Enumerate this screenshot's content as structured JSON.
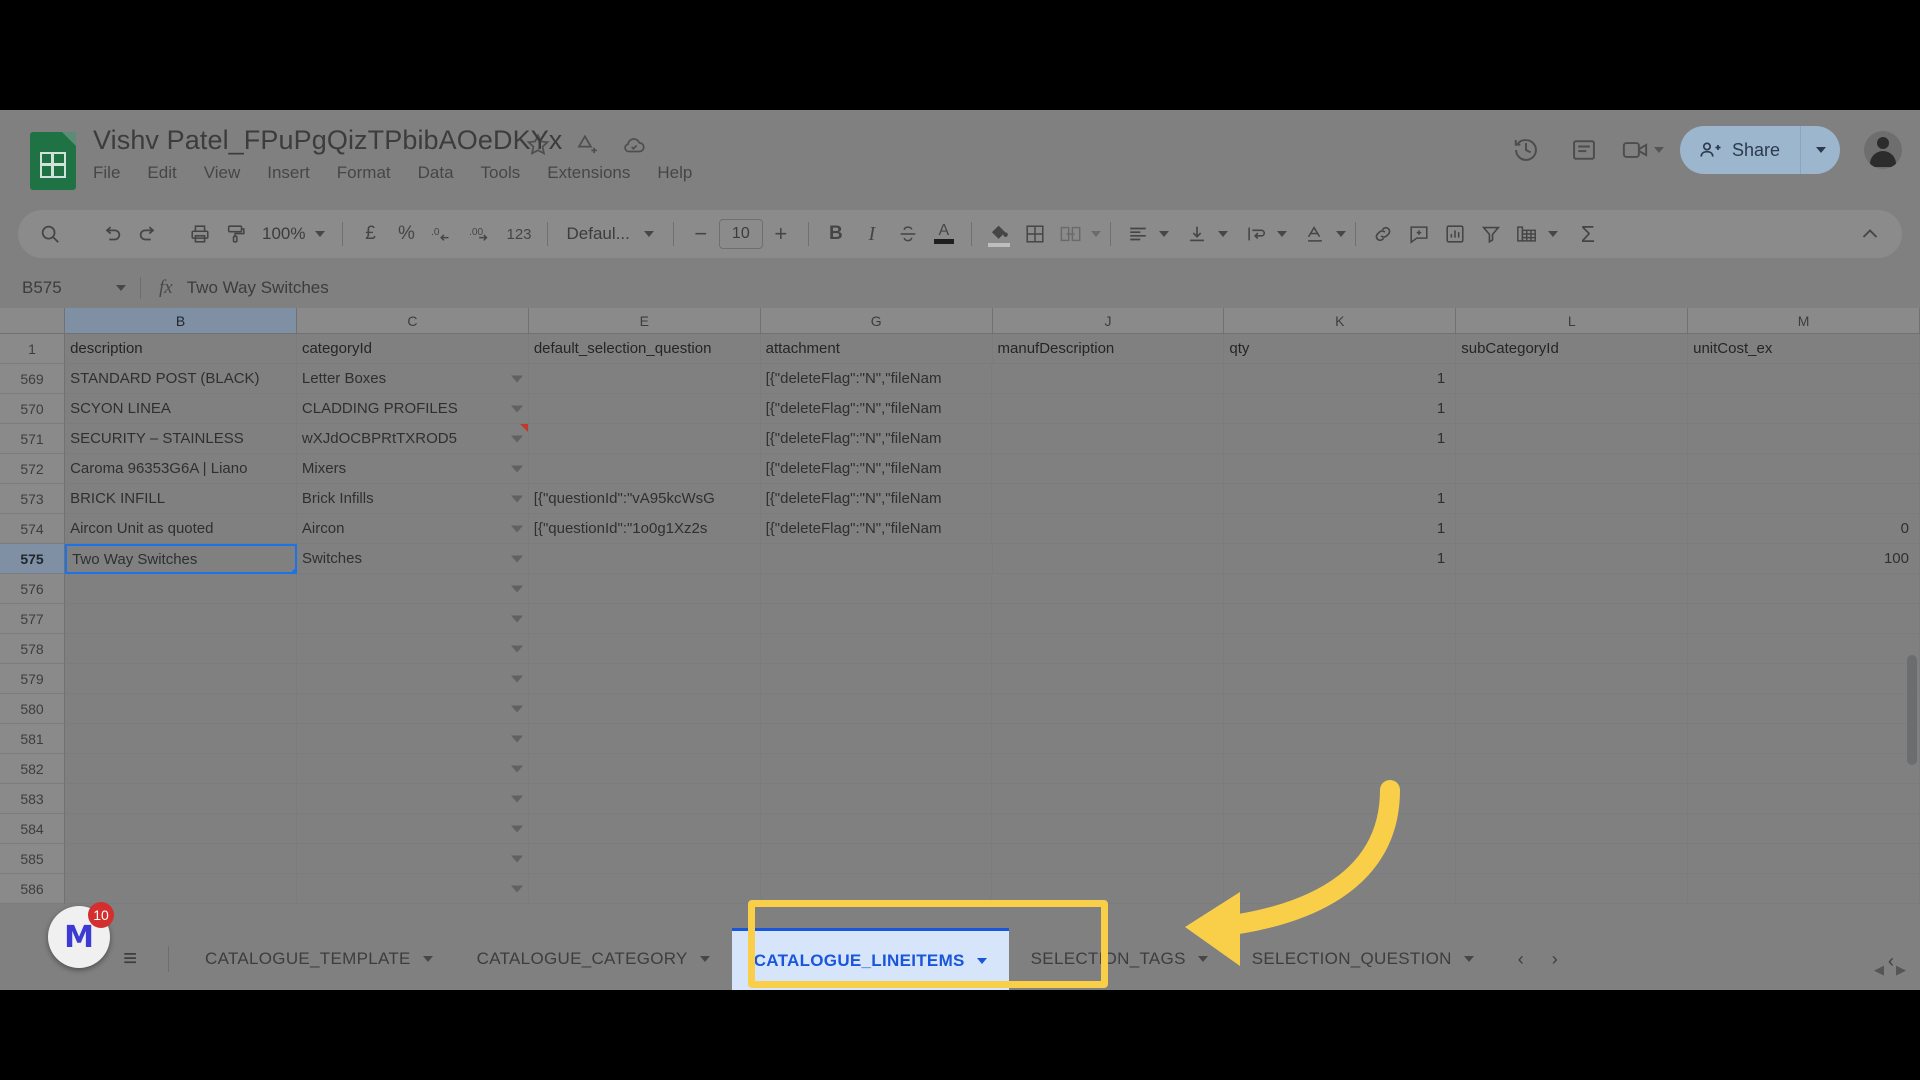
{
  "app": {
    "title": "Vishv Patel_FPuPgQizTPbibAOeDKYx",
    "menus": [
      "File",
      "Edit",
      "View",
      "Insert",
      "Format",
      "Data",
      "Tools",
      "Extensions",
      "Help"
    ],
    "share_label": "Share",
    "icons": {
      "star": "star-icon",
      "move": "move-to-drive-icon",
      "cloud": "saved-to-cloud-icon",
      "history": "version-history-icon",
      "comment": "open-comment-history-icon",
      "meet": "google-meet-icon",
      "avatar": "user-avatar"
    }
  },
  "toolbar": {
    "zoom": "100%",
    "font": "Defaul...",
    "font_size": "10",
    "currency": "£",
    "percent": "%",
    "dec_decrease": ".0",
    "dec_increase": ".00",
    "number_format": "123",
    "bold": "B",
    "italic": "I",
    "minus": "−",
    "plus": "+",
    "sigma": "Σ"
  },
  "formula_bar": {
    "cell_ref": "B575",
    "fx": "fx",
    "value": "Two Way Switches"
  },
  "grid": {
    "columns": [
      "B",
      "C",
      "E",
      "G",
      "J",
      "K",
      "L",
      "M"
    ],
    "selected_column": "B",
    "selected_row": "575",
    "header_row_number": "1",
    "headers": [
      "description",
      "categoryId",
      "default_selection_question",
      "attachment",
      "manufDescription",
      "qty",
      "subCategoryId",
      "unitCost_ex"
    ],
    "rows": [
      {
        "n": "569",
        "description": "STANDARD POST (BLACK)",
        "categoryId": "Letter Boxes",
        "default_selection_question": "",
        "attachment": "[{\"deleteFlag\":\"N\",\"fileNam",
        "manufDescription": "",
        "qty": "1",
        "subCategoryId": "",
        "unitCost_ex": "",
        "flag": false
      },
      {
        "n": "570",
        "description": "SCYON LINEA",
        "categoryId": "CLADDING PROFILES",
        "default_selection_question": "",
        "attachment": "[{\"deleteFlag\":\"N\",\"fileNam",
        "manufDescription": "",
        "qty": "1",
        "subCategoryId": "",
        "unitCost_ex": "",
        "flag": false
      },
      {
        "n": "571",
        "description": "SECURITY – STAINLESS",
        "categoryId": "wXJdOCBPRtTXROD5",
        "default_selection_question": "",
        "attachment": "[{\"deleteFlag\":\"N\",\"fileNam",
        "manufDescription": "",
        "qty": "1",
        "subCategoryId": "",
        "unitCost_ex": "",
        "flag": true
      },
      {
        "n": "572",
        "description": " Caroma 96353G6A | Liano",
        "categoryId": "Mixers",
        "default_selection_question": "",
        "attachment": "[{\"deleteFlag\":\"N\",\"fileNam",
        "manufDescription": "",
        "qty": "",
        "subCategoryId": "",
        "unitCost_ex": "",
        "flag": false
      },
      {
        "n": "573",
        "description": "BRICK INFILL",
        "categoryId": "Brick Infills",
        "default_selection_question": "[{\"questionId\":\"vA95kcWsG",
        "attachment": "[{\"deleteFlag\":\"N\",\"fileNam",
        "manufDescription": "",
        "qty": "1",
        "subCategoryId": "",
        "unitCost_ex": "",
        "flag": false
      },
      {
        "n": "574",
        "description": "Aircon Unit as quoted",
        "categoryId": "Aircon",
        "default_selection_question": "[{\"questionId\":\"1o0g1Xz2s",
        "attachment": "[{\"deleteFlag\":\"N\",\"fileNam",
        "manufDescription": "",
        "qty": "1",
        "subCategoryId": "",
        "unitCost_ex": "0",
        "flag": false
      },
      {
        "n": "575",
        "description": "Two Way Switches",
        "categoryId": "Switches",
        "default_selection_question": "",
        "attachment": "",
        "manufDescription": "",
        "qty": "1",
        "subCategoryId": "",
        "unitCost_ex": "100",
        "flag": false,
        "active": true
      },
      {
        "n": "576",
        "description": "",
        "categoryId": "",
        "default_selection_question": "",
        "attachment": "",
        "manufDescription": "",
        "qty": "",
        "subCategoryId": "",
        "unitCost_ex": "",
        "flag": false
      },
      {
        "n": "577",
        "description": "",
        "categoryId": "",
        "default_selection_question": "",
        "attachment": "",
        "manufDescription": "",
        "qty": "",
        "subCategoryId": "",
        "unitCost_ex": "",
        "flag": false
      },
      {
        "n": "578",
        "description": "",
        "categoryId": "",
        "default_selection_question": "",
        "attachment": "",
        "manufDescription": "",
        "qty": "",
        "subCategoryId": "",
        "unitCost_ex": "",
        "flag": false
      },
      {
        "n": "579",
        "description": "",
        "categoryId": "",
        "default_selection_question": "",
        "attachment": "",
        "manufDescription": "",
        "qty": "",
        "subCategoryId": "",
        "unitCost_ex": "",
        "flag": false
      },
      {
        "n": "580",
        "description": "",
        "categoryId": "",
        "default_selection_question": "",
        "attachment": "",
        "manufDescription": "",
        "qty": "",
        "subCategoryId": "",
        "unitCost_ex": "",
        "flag": false
      },
      {
        "n": "581",
        "description": "",
        "categoryId": "",
        "default_selection_question": "",
        "attachment": "",
        "manufDescription": "",
        "qty": "",
        "subCategoryId": "",
        "unitCost_ex": "",
        "flag": false
      },
      {
        "n": "582",
        "description": "",
        "categoryId": "",
        "default_selection_question": "",
        "attachment": "",
        "manufDescription": "",
        "qty": "",
        "subCategoryId": "",
        "unitCost_ex": "",
        "flag": false
      },
      {
        "n": "583",
        "description": "",
        "categoryId": "",
        "default_selection_question": "",
        "attachment": "",
        "manufDescription": "",
        "qty": "",
        "subCategoryId": "",
        "unitCost_ex": "",
        "flag": false
      },
      {
        "n": "584",
        "description": "",
        "categoryId": "",
        "default_selection_question": "",
        "attachment": "",
        "manufDescription": "",
        "qty": "",
        "subCategoryId": "",
        "unitCost_ex": "",
        "flag": false
      },
      {
        "n": "585",
        "description": "",
        "categoryId": "",
        "default_selection_question": "",
        "attachment": "",
        "manufDescription": "",
        "qty": "",
        "subCategoryId": "",
        "unitCost_ex": "",
        "flag": false
      },
      {
        "n": "586",
        "description": "",
        "categoryId": "",
        "default_selection_question": "",
        "attachment": "",
        "manufDescription": "",
        "qty": "",
        "subCategoryId": "",
        "unitCost_ex": "",
        "flag": false
      }
    ]
  },
  "watermark": {
    "letter": "M",
    "badge": "10"
  },
  "tabs": {
    "add_label": "+",
    "all_sheets_label": "≡",
    "items": [
      {
        "label": "CATALOGUE_TEMPLATE",
        "active": false
      },
      {
        "label": "CATALOGUE_CATEGORY",
        "active": false
      },
      {
        "label": "CATALOGUE_LINEITEMS",
        "active": true
      },
      {
        "label": "SELECTION_TAGS",
        "active": false
      },
      {
        "label": "SELECTION_QUESTION",
        "active": false
      }
    ],
    "prev": "‹",
    "next": "›",
    "right_collapse": "‹"
  },
  "annotation": {
    "highlight_color": "#f9cf4a",
    "target": "CATALOGUE_LINEITEMS"
  }
}
